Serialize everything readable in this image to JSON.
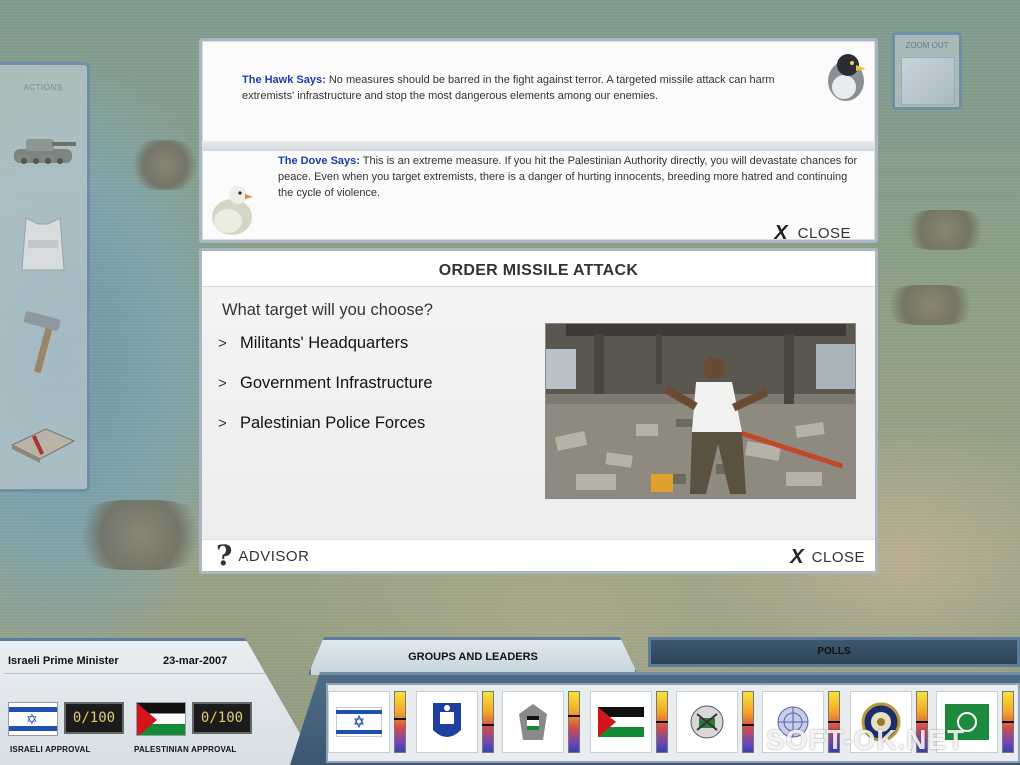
{
  "actions": {
    "title": "ACTIONS",
    "items": [
      "tank-icon",
      "vest-icon",
      "hammer-icon",
      "book-icon"
    ]
  },
  "zoom": {
    "label": "ZOOM OUT"
  },
  "advice": {
    "hawk": {
      "speaker": "The Hawk Says:",
      "text": "No measures should be barred in the fight against terror. A targeted missile attack can harm extremists' infrastructure and stop the most dangerous elements among our enemies."
    },
    "dove": {
      "speaker": "The Dove Says:",
      "text": "This is an extreme measure. If you hit the Palestinian Authority directly, you will devastate chances for peace. Even when you target extremists, there is a danger of hurting innocents, breeding more hatred and continuing the cycle of violence."
    },
    "close_label": "CLOSE"
  },
  "dialog": {
    "title": "ORDER MISSILE ATTACK",
    "question": "What target will you choose?",
    "options": [
      "Militants' Headquarters",
      "Government Infrastructure",
      "Palestinian Police Forces"
    ],
    "advisor_label": "ADVISOR",
    "close_label": "CLOSE"
  },
  "status": {
    "role": "Israeli Prime Minister",
    "date": "23-mar-2007",
    "israeli_score": "0/100",
    "israeli_label": "ISRAELI APPROVAL",
    "palestinian_score": "0/100",
    "palestinian_label": "PALESTINIAN APPROVAL"
  },
  "tabs": {
    "groups": "GROUPS AND LEADERS",
    "polls": "POLLS"
  },
  "leaders": [
    {
      "icon": "israel-flag-icon",
      "level": 0.55
    },
    {
      "icon": "emblem-icon",
      "level": 0.45
    },
    {
      "icon": "palestinian-authority-emblem-icon",
      "level": 0.6
    },
    {
      "icon": "palestine-flag-icon",
      "level": 0.5
    },
    {
      "icon": "hamas-emblem-icon",
      "level": 0.45
    },
    {
      "icon": "un-emblem-icon",
      "level": 0.5
    },
    {
      "icon": "usa-seal-icon",
      "level": 0.5
    },
    {
      "icon": "arab-league-icon",
      "level": 0.5
    }
  ],
  "watermark": "SOFT-OK.NET",
  "colors": {
    "frame": "#5c7c9b",
    "speaker": "#1b3fa8",
    "score_text": "#e8c870"
  }
}
